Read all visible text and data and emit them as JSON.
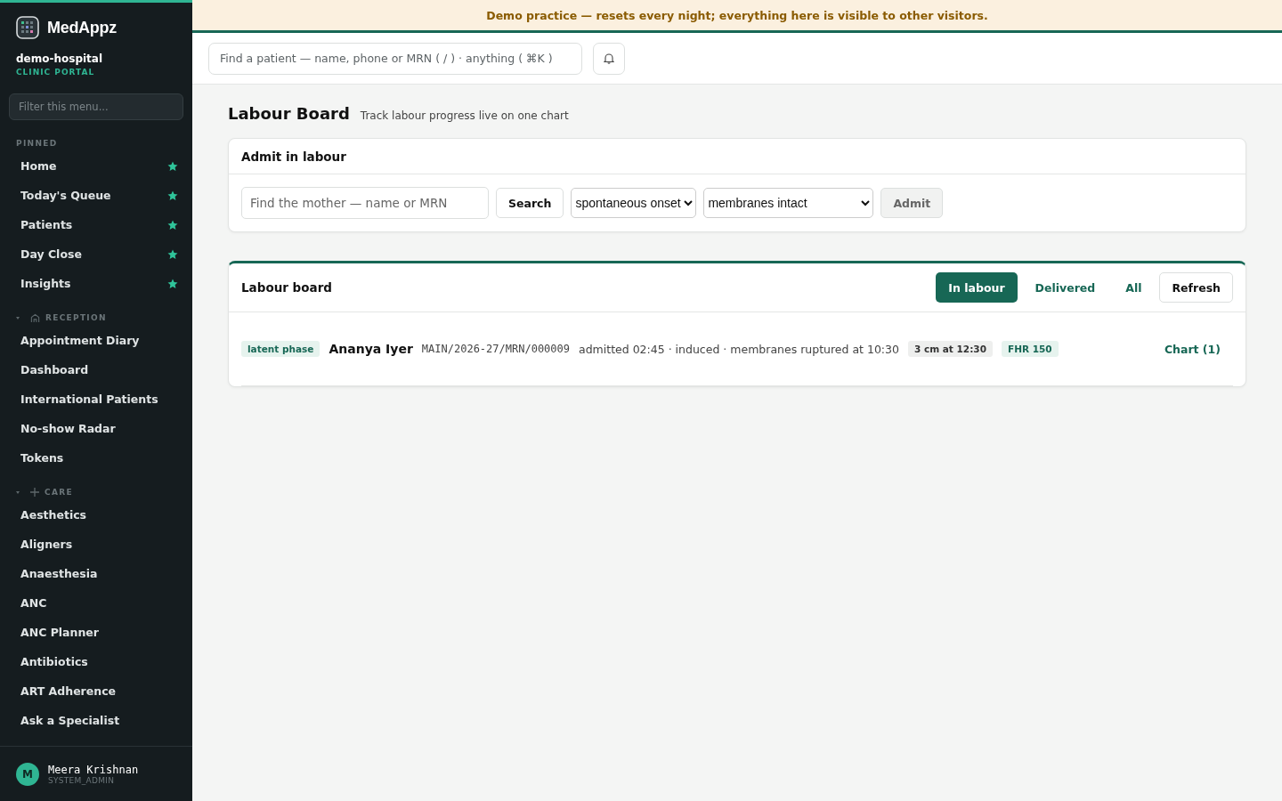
{
  "brand": {
    "name": "MedAppz",
    "org": "demo-hospital",
    "portal": "CLINIC PORTAL"
  },
  "sidebar": {
    "filter_placeholder": "Filter this menu...",
    "sections": [
      {
        "title": "PINNED",
        "kind": "pinned",
        "items": [
          {
            "label": "Home",
            "pinned": true
          },
          {
            "label": "Today's Queue",
            "pinned": true
          },
          {
            "label": "Patients",
            "pinned": true
          },
          {
            "label": "Day Close",
            "pinned": true
          },
          {
            "label": "Insights",
            "pinned": true
          }
        ]
      },
      {
        "title": "RECEPTION",
        "kind": "reception",
        "expanded": true,
        "items": [
          {
            "label": "Appointment Diary",
            "pinned": false
          },
          {
            "label": "Dashboard",
            "pinned": false
          },
          {
            "label": "International Patients",
            "pinned": false
          },
          {
            "label": "No-show Radar",
            "pinned": false
          },
          {
            "label": "Tokens",
            "pinned": false
          }
        ]
      },
      {
        "title": "CARE",
        "kind": "care",
        "expanded": true,
        "items": [
          {
            "label": "Aesthetics",
            "pinned": false
          },
          {
            "label": "Aligners",
            "pinned": false
          },
          {
            "label": "Anaesthesia",
            "pinned": false
          },
          {
            "label": "ANC",
            "pinned": false
          },
          {
            "label": "ANC Planner",
            "pinned": false
          },
          {
            "label": "Antibiotics",
            "pinned": false
          },
          {
            "label": "ART Adherence",
            "pinned": false
          },
          {
            "label": "Ask a Specialist",
            "pinned": false
          }
        ]
      }
    ],
    "user": {
      "initial": "M",
      "name": "Meera Krishnan",
      "role": "SYSTEM_ADMIN"
    }
  },
  "banner": "Demo practice — resets every night; everything here is visible to other visitors.",
  "topbar": {
    "search_placeholder": "Find a patient — name, phone or MRN ( / ) · anything ( ⌘K )"
  },
  "page": {
    "title": "Labour Board",
    "subtitle": "Track labour progress live on one chart"
  },
  "admit": {
    "title": "Admit in labour",
    "search_placeholder": "Find the mother — name or MRN",
    "search_button": "Search",
    "onset": "spontaneous onset",
    "membranes": "membranes intact",
    "admit_button": "Admit",
    "admit_disabled": true
  },
  "board": {
    "title": "Labour board",
    "filters": [
      {
        "label": "In labour",
        "selected": true
      },
      {
        "label": "Delivered",
        "selected": false
      },
      {
        "label": "All",
        "selected": false
      }
    ],
    "refresh": "Refresh",
    "rows": [
      {
        "phase": "latent phase",
        "name": "Ananya Iyer",
        "mrn": "MAIN/2026-27/MRN/000009",
        "details": "admitted 02:45 · induced · membranes ruptured at 10:30",
        "dilation": "3 cm at 12:30",
        "fhr": "FHR 150",
        "chart": "Chart (1)"
      }
    ]
  }
}
